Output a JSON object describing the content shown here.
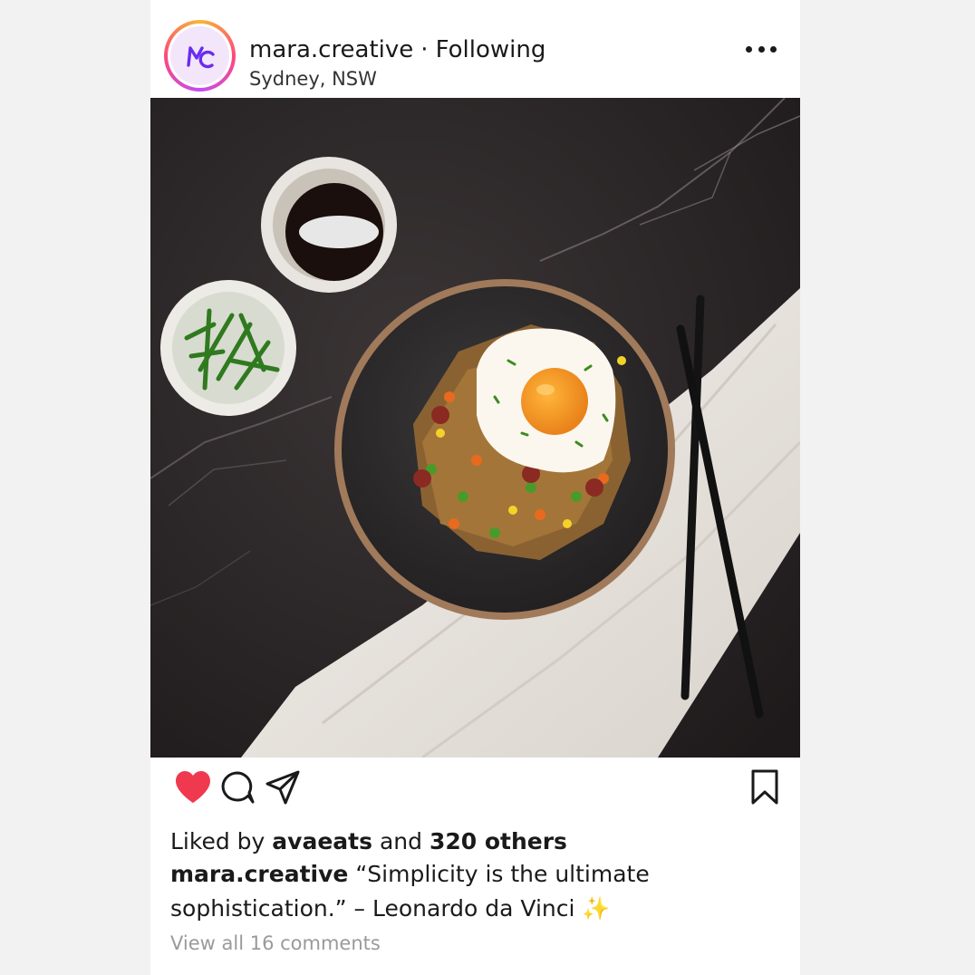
{
  "post": {
    "username": "mara.creative",
    "separator": "·",
    "follow_status": "Following",
    "location": "Sydney, NSW",
    "avatar_monogram": "MC",
    "more_icon": "more-horizontal-icon"
  },
  "actions": {
    "like_icon": "heart-icon",
    "liked": true,
    "like_color": "#f0394f",
    "comment_icon": "comment-icon",
    "share_icon": "send-icon",
    "save_icon": "bookmark-icon"
  },
  "likes": {
    "prefix": "Liked by",
    "first_user": "avaeats",
    "joiner": "and",
    "others": "320 others"
  },
  "caption": {
    "username": "mara.creative",
    "text": "“Simplicity is the ultimate sophistication.” – Leonardo da Vinci ✨"
  },
  "comments": {
    "label": "View all 16 comments"
  },
  "colors": {
    "avatar_accent": "#6a2cf0",
    "muted_text": "#9a9a9a"
  }
}
